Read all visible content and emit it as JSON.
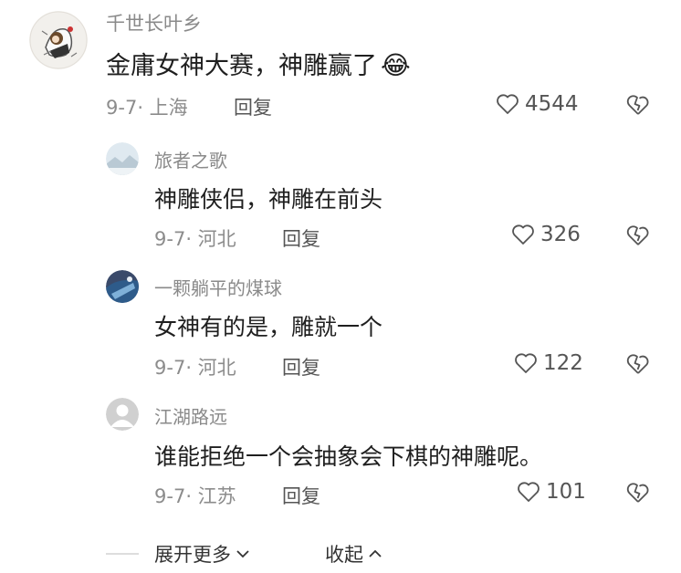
{
  "comments": [
    {
      "user": "千世长叶乡",
      "text": "金庸女神大赛，神雕赢了",
      "emoji": "😂",
      "date": "9-7",
      "location": "上海",
      "reply_label": "回复",
      "likes": "4544"
    },
    {
      "user": "旅者之歌",
      "text": "神雕侠侣，神雕在前头",
      "date": "9-7",
      "location": "河北",
      "reply_label": "回复",
      "likes": "326"
    },
    {
      "user": "一颗躺平的煤球",
      "text": "女神有的是，雕就一个",
      "date": "9-7",
      "location": "河北",
      "reply_label": "回复",
      "likes": "122"
    },
    {
      "user": "江湖路远",
      "text": "谁能拒绝一个会抽象会下棋的神雕呢。",
      "date": "9-7",
      "location": "江苏",
      "reply_label": "回复",
      "likes": "101"
    }
  ],
  "footer": {
    "expand_label": "展开更多",
    "collapse_label": "收起"
  },
  "icons": {
    "like": "heart-outline-icon",
    "dislike": "broken-heart-icon",
    "expand": "chevron-down-icon",
    "collapse": "chevron-up-icon"
  },
  "colors": {
    "text": "#1f1f1f",
    "secondary": "#8c8c8c",
    "avatar_gray": "#c8c8c8"
  }
}
